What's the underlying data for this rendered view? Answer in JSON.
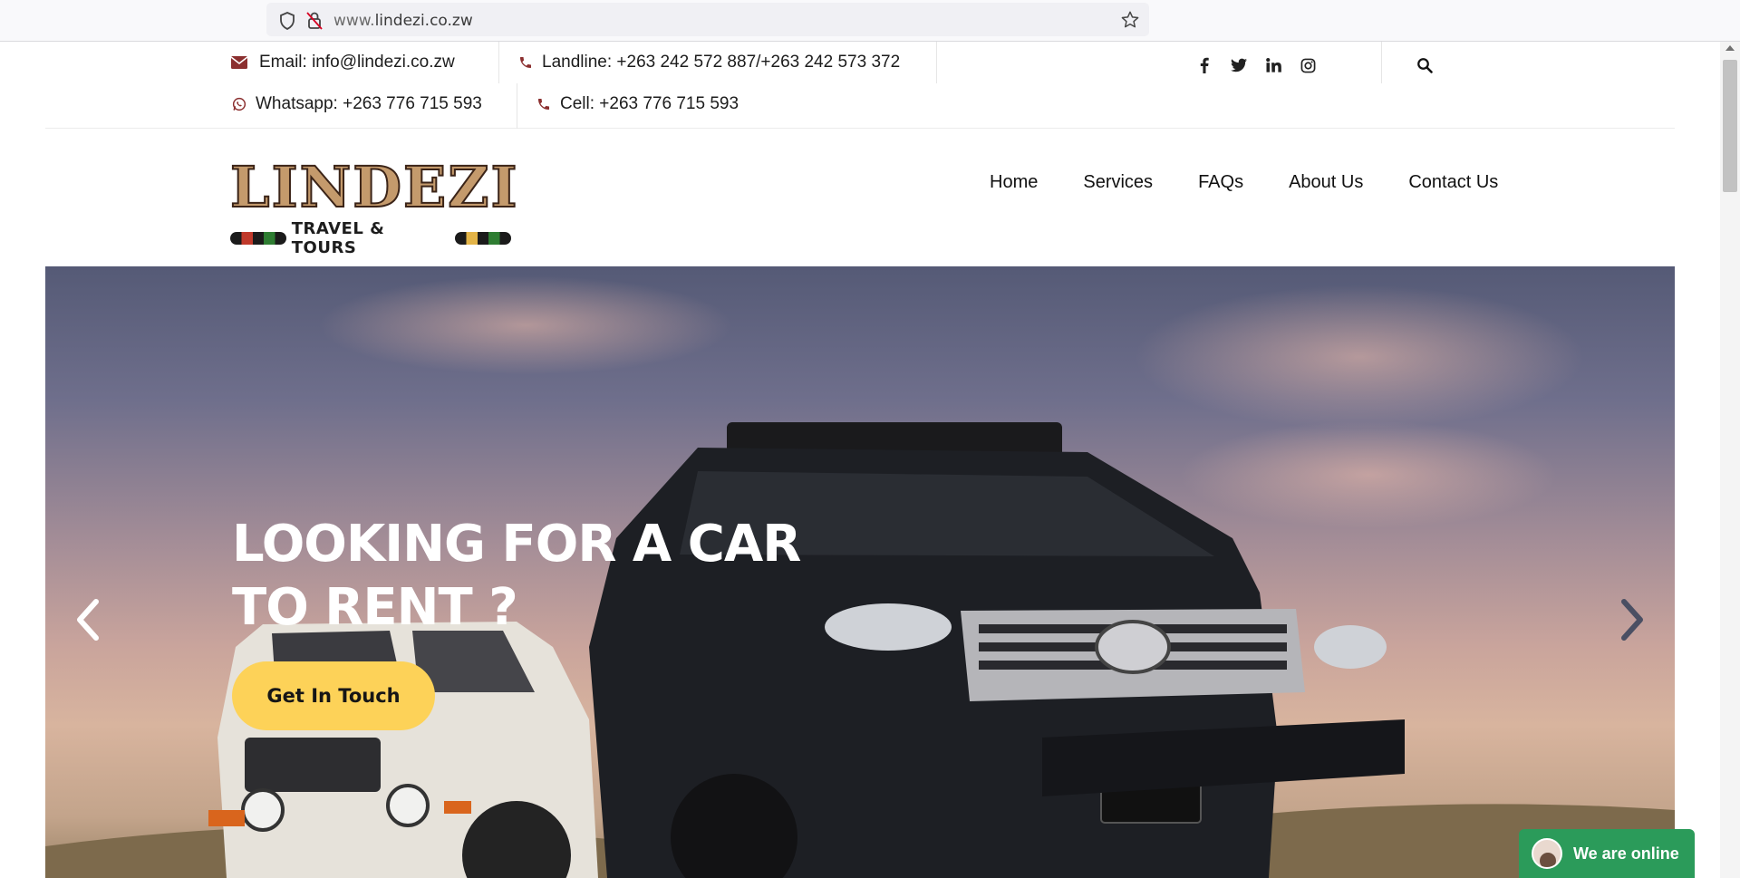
{
  "browser": {
    "url_prefix": "www.",
    "url_domain": "lindezi.co.zw"
  },
  "topbar": {
    "email": "Email: info@lindezi.co.zw",
    "landline": "Landline: +263 242 572 887/+263 242 573 372",
    "whatsapp": "Whatsapp: +263 776 715 593",
    "cell": "Cell: +263 776 715 593",
    "social_icons": [
      "facebook-icon",
      "twitter-icon",
      "linkedin-icon",
      "instagram-icon"
    ]
  },
  "logo": {
    "word": "LINDEZI",
    "tagline": "TRAVEL & TOURS"
  },
  "nav": {
    "items": [
      "Home",
      "Services",
      "FAQs",
      "About Us",
      "Contact Us"
    ]
  },
  "hero": {
    "title": "LOOKING FOR A CAR TO RENT ?",
    "cta_label": "Get In Touch"
  },
  "chat": {
    "label": "We are online"
  },
  "colors": {
    "accent": "#fdd258",
    "chat": "#2b9b5a",
    "icon": "#8b2f2f"
  }
}
